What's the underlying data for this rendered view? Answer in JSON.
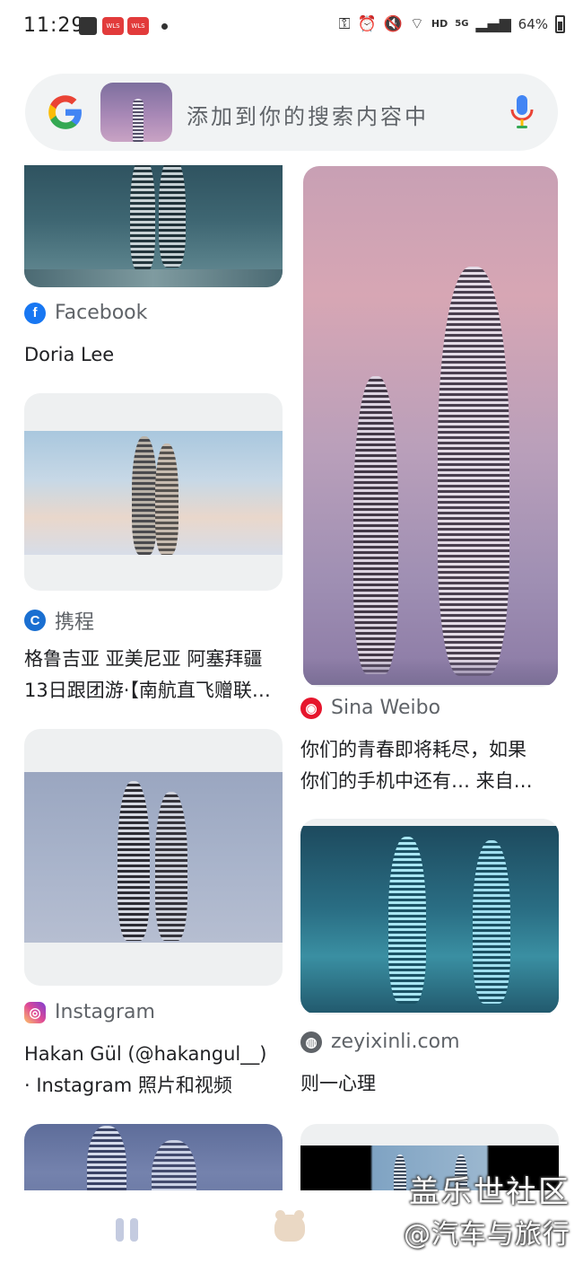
{
  "status_bar": {
    "time": "11:29",
    "app_badge_1": "WLS",
    "app_badge_2": "WLS",
    "network_hd": "HD",
    "network_5g": "5G",
    "battery": "64%"
  },
  "search": {
    "placeholder": "添加到你的搜索内容中"
  },
  "results_left": [
    {
      "source": "Facebook",
      "icon": "facebook-icon",
      "title_lines": [
        "Doria Lee"
      ]
    },
    {
      "source": "携程",
      "icon": "ctrip-icon",
      "title_lines": [
        "格鲁吉亚 亚美尼亚 阿塞拜疆",
        "13日跟团游·【南航直飞赠联…"
      ]
    },
    {
      "source": "Instagram",
      "icon": "instagram-icon",
      "title_lines": [
        "Hakan Gül (@hakangul__)",
        "· Instagram 照片和视频"
      ]
    }
  ],
  "results_right": [
    {
      "source": "Sina Weibo",
      "icon": "weibo-icon",
      "title_lines": [
        "你们的青春即将耗尽，如果",
        "你们的手机中还有… 来自…"
      ]
    },
    {
      "source": "zeyixinli.com",
      "icon": "globe-icon",
      "title_lines": [
        "则一心理"
      ]
    }
  ],
  "watermark": {
    "line1": "盖乐世社区",
    "line2": "@汽车与旅行"
  },
  "colors": {
    "google_blue": "#4285F4",
    "google_red": "#EA4335",
    "google_yellow": "#FBBC05",
    "google_green": "#34A853",
    "facebook": "#1877F2",
    "weibo": "#E6162D"
  }
}
